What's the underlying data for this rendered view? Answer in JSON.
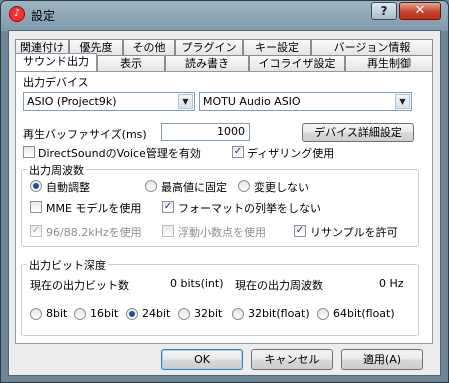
{
  "window": {
    "title": "設定",
    "app_icon": "music-app-icon",
    "help_label": "?",
    "close_label": "✕"
  },
  "tabs": {
    "back_row": [
      "関連付け",
      "優先度",
      "その他",
      "プラグイン",
      "キー設定",
      "バージョン情報"
    ],
    "front_row": [
      "サウンド出力",
      "表示",
      "読み書き",
      "イコライザ設定",
      "再生制御"
    ],
    "active": "サウンド出力"
  },
  "output_device": {
    "label": "出力デバイス",
    "device_type": "ASIO (Project9k)",
    "device_name": "MOTU Audio ASIO"
  },
  "buffer": {
    "label": "再生バッファサイズ(ms)",
    "value": "1000",
    "detail_button": "デバイス詳細設定"
  },
  "options": {
    "directsound": "DirectSoundのVoice管理を有効",
    "dithering": "ディザリング使用"
  },
  "output_frequency": {
    "label": "出力周波数",
    "radio_auto": "自動調整",
    "radio_max": "最高値に固定",
    "radio_none": "変更しない",
    "mme": "MME モデルを使用",
    "format_enum": "フォーマットの列挙をしない",
    "hz_96_88": "96/88.2kHzを使用",
    "float_dec": "浮動小数点を使用",
    "resample": "リサンプルを許可"
  },
  "output_bit_depth": {
    "label": "出力ビット深度",
    "current_bits_label": "現在の出力ビット数",
    "current_bits_value": "0 bits(int)",
    "current_freq_label": "現在の出力周波数",
    "current_freq_value": "0 Hz",
    "options": [
      "8bit",
      "16bit",
      "24bit",
      "32bit",
      "32bit(float)",
      "64bit(float)"
    ],
    "selected": "24bit"
  },
  "buttons": {
    "ok": "OK",
    "cancel": "キャンセル",
    "apply": "適用(A)"
  }
}
